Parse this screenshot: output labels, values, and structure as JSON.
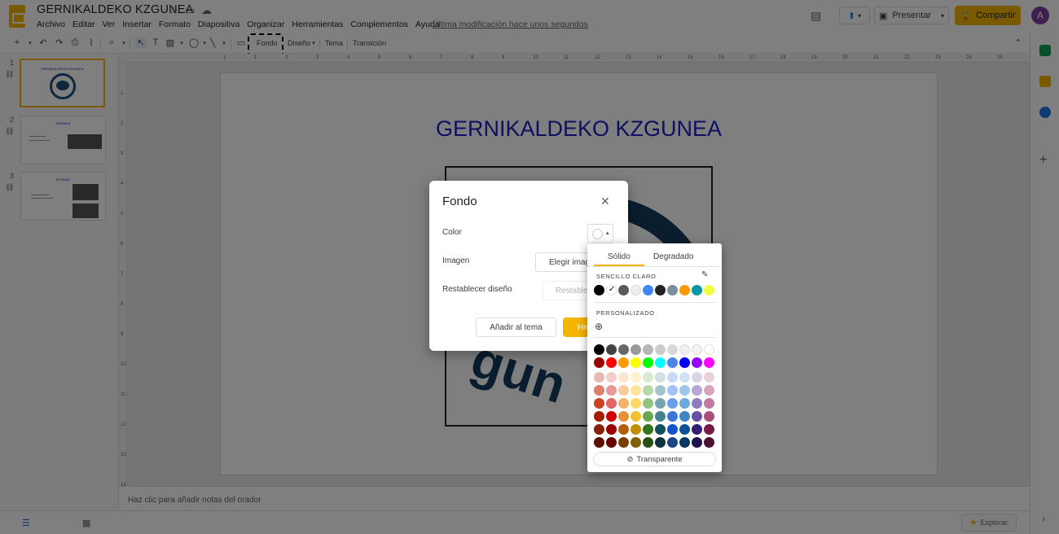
{
  "app": {
    "title": "GERNIKALDEKO KZGUNEA",
    "menu": [
      "Archivo",
      "Editar",
      "Ver",
      "Insertar",
      "Formato",
      "Diapositiva",
      "Organizar",
      "Herramientas",
      "Complementos",
      "Ayuda"
    ],
    "last_modified": "Última modificación hace unos segundos",
    "present_label": "Presentar",
    "share_label": "Compartir",
    "avatar_letter": "A"
  },
  "toolbar": {
    "fondo": "Fondo",
    "diseno": "Diseño",
    "tema": "Tema",
    "transicion": "Transición"
  },
  "slides": [
    {
      "num": "1",
      "title": "GERNIKALDEKO KZGUNEA"
    },
    {
      "num": "2",
      "title": "GERNIKA"
    },
    {
      "num": "3",
      "title": "EUSKADI"
    }
  ],
  "slide": {
    "title": "GERNIKALDEKO KZGUNEA",
    "logo_letters": "gun"
  },
  "ruler_numbers": [
    "1",
    "1",
    "2",
    "3",
    "4",
    "5",
    "6",
    "7",
    "8",
    "9",
    "10",
    "11",
    "12",
    "13",
    "14",
    "15",
    "16",
    "17",
    "18",
    "19",
    "20",
    "21",
    "22",
    "23",
    "24",
    "25"
  ],
  "ruler_left_numbers": [
    "1",
    "2",
    "3",
    "4",
    "5",
    "6",
    "7",
    "8",
    "9",
    "10",
    "11",
    "12",
    "13",
    "14"
  ],
  "notes_placeholder": "Haz clic para añadir notas del orador",
  "explore_label": "Explorar",
  "dialog": {
    "title": "Fondo",
    "color_label": "Color",
    "image_label": "Imagen",
    "reset_label": "Restablecer diseño",
    "choose_image": "Elegir imagen",
    "reset_button": "Restablecer",
    "add_to_theme": "Añadir al tema",
    "done": "Hecho"
  },
  "palette": {
    "tab_solid": "Sólido",
    "tab_gradient": "Degradado",
    "section_theme": "SENCILLO CLARO",
    "section_custom": "PERSONALIZADO",
    "transparent": "Transparente",
    "theme_colors": [
      "#000000",
      "#ffffff",
      "#595959",
      "#eeeeee",
      "#4285f4",
      "#212121",
      "#78909c",
      "#ff9800",
      "#0097a7",
      "#eeff41"
    ],
    "grid": [
      [
        "#000000",
        "#434343",
        "#666666",
        "#999999",
        "#b7b7b7",
        "#cccccc",
        "#d9d9d9",
        "#efefef",
        "#f3f3f3",
        "#ffffff"
      ],
      [
        "#980000",
        "#ff0000",
        "#ff9900",
        "#ffff00",
        "#00ff00",
        "#00ffff",
        "#4a86e8",
        "#0000ff",
        "#9900ff",
        "#ff00ff"
      ],
      [
        "#e6b8af",
        "#f4cccc",
        "#fce5cd",
        "#fff2cc",
        "#d9ead3",
        "#d0e0e3",
        "#c9daf8",
        "#cfe2f3",
        "#d9d2e9",
        "#ead1dc"
      ],
      [
        "#dd7e6b",
        "#ea9999",
        "#f9cb9c",
        "#ffe599",
        "#b6d7a8",
        "#a2c4c9",
        "#a4c2f4",
        "#9fc5e8",
        "#b4a7d6",
        "#d5a6bd"
      ],
      [
        "#cc4125",
        "#e06666",
        "#f6b26b",
        "#ffd966",
        "#93c47d",
        "#76a5af",
        "#6d9eeb",
        "#6fa8dc",
        "#8e7cc3",
        "#c27ba0"
      ],
      [
        "#a61c00",
        "#cc0000",
        "#e69138",
        "#f1c232",
        "#6aa84f",
        "#45818e",
        "#3c78d8",
        "#3d85c6",
        "#674ea7",
        "#a64d79"
      ],
      [
        "#85200c",
        "#990000",
        "#b45f06",
        "#bf9000",
        "#38761d",
        "#134f5c",
        "#1155cc",
        "#0b5394",
        "#351c75",
        "#741b47"
      ],
      [
        "#5b0f00",
        "#660000",
        "#783f04",
        "#7f6000",
        "#274e13",
        "#0c343d",
        "#1c4587",
        "#073763",
        "#20124d",
        "#4c1130"
      ]
    ]
  }
}
